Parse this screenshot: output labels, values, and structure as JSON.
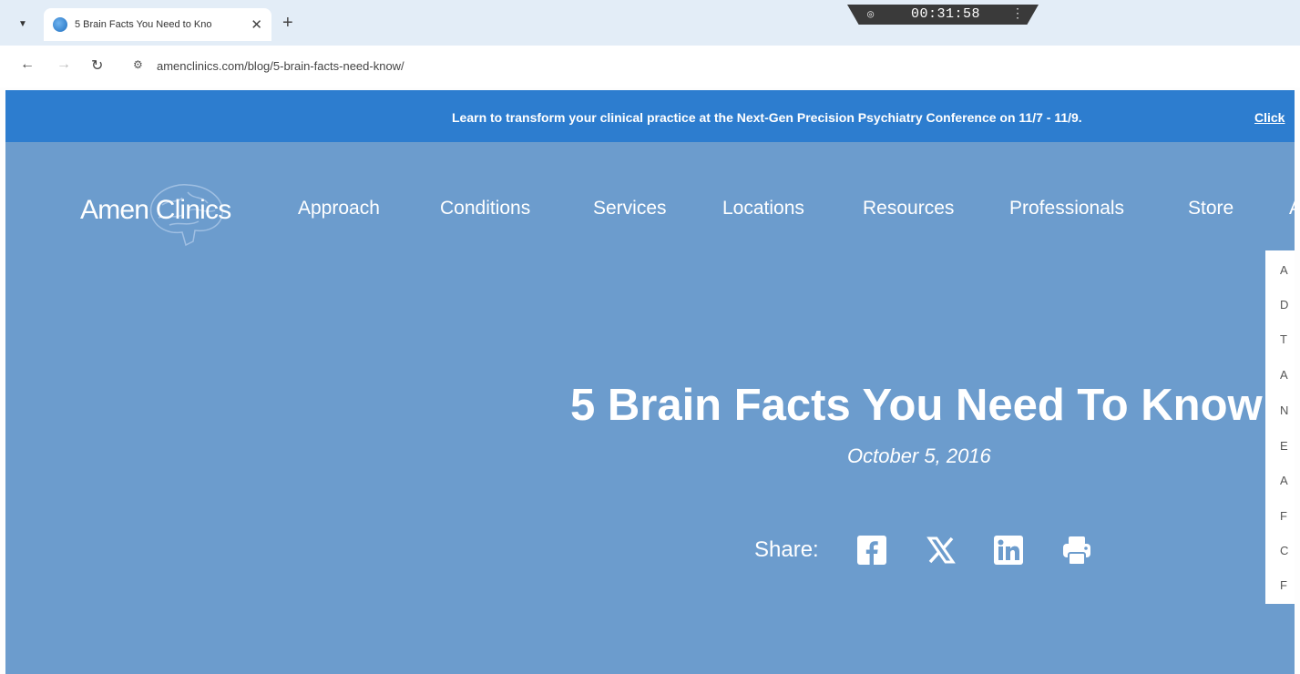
{
  "browser": {
    "tab_title": "5 Brain Facts You Need to Kno",
    "tab_close": "✕",
    "new_tab": "+",
    "url": "amenclinics.com/blog/5-brain-facts-need-know/"
  },
  "recorder": {
    "time": "00:31:58"
  },
  "page": {
    "announcement": {
      "text": "Learn to transform your clinical practice at the Next-Gen Precision Psychiatry Conference on 11/7 - 11/9.",
      "link": "Click"
    },
    "logo_text": "Amen Clinics",
    "nav": [
      "Approach",
      "Conditions",
      "Services",
      "Locations",
      "Resources",
      "Professionals",
      "Store",
      "A"
    ],
    "dropdown_items": [
      "A",
      "D",
      "T",
      "A",
      "N",
      "E",
      "A",
      "F",
      "C",
      "F"
    ],
    "article": {
      "title": "5 Brain Facts You Need To Know",
      "date": "October 5, 2016"
    },
    "share": {
      "label": "Share:",
      "icons": [
        "facebook-icon",
        "x-icon",
        "linkedin-icon",
        "print-icon"
      ]
    }
  },
  "colors": {
    "announcement_bar": "#2d7dcf",
    "hero_background": "#6c9ccd",
    "tab_strip": "#e3edf7"
  }
}
